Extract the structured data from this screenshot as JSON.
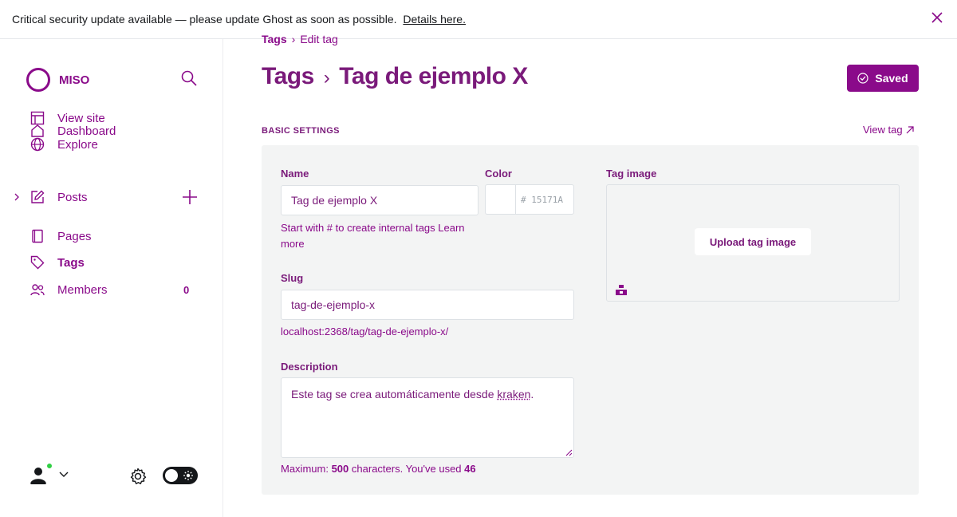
{
  "banner": {
    "message": "Critical security update available — please update Ghost as soon as possible.",
    "link": "Details here."
  },
  "sidebar": {
    "site_name": "MISO",
    "items": [
      {
        "label": "View site",
        "icon": "layout-icon"
      },
      {
        "label": "Dashboard",
        "icon": "home-icon"
      },
      {
        "label": "Explore",
        "icon": "globe-icon"
      },
      {
        "label": "Posts",
        "icon": "edit-icon"
      },
      {
        "label": "Pages",
        "icon": "pages-icon"
      },
      {
        "label": "Tags",
        "icon": "tag-icon"
      },
      {
        "label": "Members",
        "icon": "members-icon"
      }
    ],
    "members_count": "0"
  },
  "breadcrumb": {
    "root": "Tags",
    "current": "Edit tag"
  },
  "header": {
    "title_root": "Tags",
    "title_tag": "Tag de ejemplo X",
    "save_label": "Saved"
  },
  "section": {
    "title": "BASIC SETTINGS",
    "view_tag": "View tag"
  },
  "form": {
    "name_label": "Name",
    "name_value": "Tag de ejemplo X",
    "name_hint": "Start with # to create internal tags Learn more",
    "color_label": "Color",
    "color_value": "15171A",
    "color_prefix": "#",
    "image_label": "Tag image",
    "upload_label": "Upload tag image",
    "slug_label": "Slug",
    "slug_value": "tag-de-ejemplo-x",
    "slug_hint": "localhost:2368/tag/tag-de-ejemplo-x/",
    "description_label": "Description",
    "description_text": "Este tag se crea automáticamente desde",
    "description_link": "kraken",
    "description_end": ".",
    "description_hint_prefix": "Maximum:",
    "description_max": "500",
    "description_hint_middle": "characters. You've used",
    "description_used": "46"
  }
}
